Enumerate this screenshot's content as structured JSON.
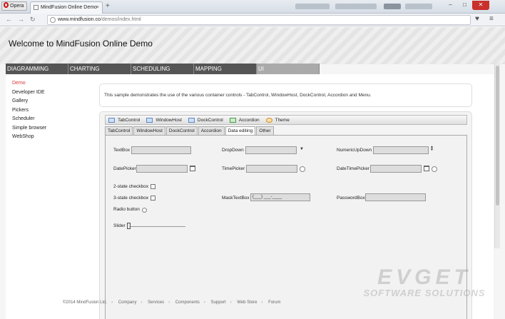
{
  "browser": {
    "menu_label": "Opera",
    "tab_title": "MindFusion Online Demo",
    "new_tab_label": "+",
    "url_domain": "www.mindfusion.co",
    "url_path": "/demos/index.html",
    "window_controls": [
      "–",
      "□",
      "✕"
    ]
  },
  "page": {
    "welcome": "Welcome to MindFusion Online Demo",
    "top_nav": [
      {
        "label": "DIAGRAMMING"
      },
      {
        "label": "CHARTING"
      },
      {
        "label": "SCHEDULING"
      },
      {
        "label": "MAPPING"
      },
      {
        "label": "UI"
      }
    ],
    "side_menu": [
      {
        "label": "Demo"
      },
      {
        "label": "Developer IDE"
      },
      {
        "label": "Gallery"
      },
      {
        "label": "Pickers"
      },
      {
        "label": "Scheduler"
      },
      {
        "label": "Simple browser"
      },
      {
        "label": "WebShop"
      }
    ],
    "description": "This sample demonstrates the use of the various container controls - TabControl, WindowHost, DockControl, Accordion and Menu.",
    "toolbar": [
      "TabControl",
      "WindowHost",
      "DockControl",
      "Accordion",
      "Theme"
    ],
    "control_tabs": [
      "TabControl",
      "WindowHost",
      "DockControl",
      "Accordion",
      "Data editing",
      "Other"
    ],
    "form": {
      "textbox_label": "TextBox",
      "dropdown_label": "DropDown",
      "numericupdown_label": "NumericUpDown",
      "datepicker_label": "DatePicker",
      "timepicker_label": "TimePicker",
      "datetimepicker_label": "DateTimePicker",
      "checkbox2_label": "2-state checkbox",
      "checkbox3_label": "3-state checkbox",
      "masktextbox_label": "MaskTextBox",
      "masktextbox_value": "(___) ___-____",
      "passwordbox_label": "PasswordBox",
      "radio_label": "Radio button",
      "slider_label": "Slider"
    },
    "footer": [
      "©2014 MindFusion Ltd.",
      "Company",
      "Services",
      "Components",
      "Support",
      "Web Store",
      "Forum"
    ]
  },
  "watermark": {
    "line1": "EVGET",
    "line2": "SOFTWARE SOLUTIONS"
  },
  "colors": {
    "nav_bg": "#555555",
    "nav_active": "#aaaaaa",
    "active_link": "#dd3333"
  }
}
